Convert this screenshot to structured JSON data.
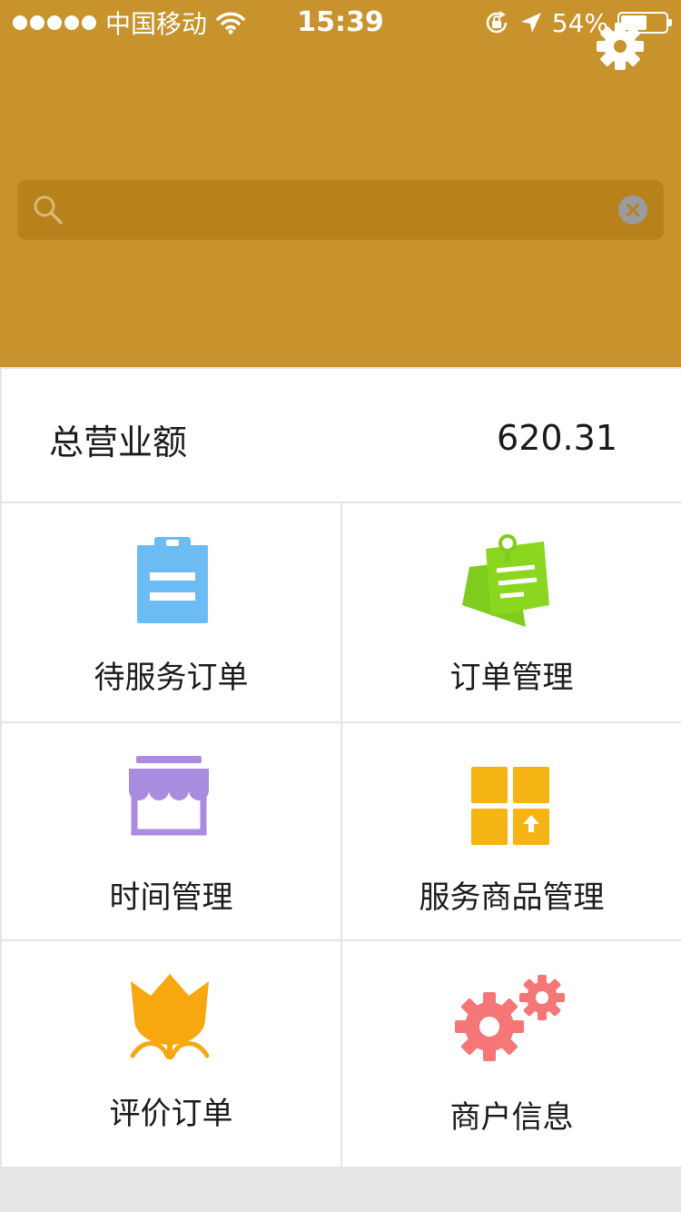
{
  "status_bar": {
    "carrier": "中国移动",
    "time": "15:39",
    "battery": "54%"
  },
  "search": {
    "placeholder": "",
    "value": ""
  },
  "summary": {
    "revenue_label": "总营业额",
    "revenue_value": "620.31"
  },
  "menu": [
    {
      "label": "待服务订单",
      "icon": "clipboard-icon",
      "color": "#6cbcf3"
    },
    {
      "label": "订单管理",
      "icon": "sticky-note-icon",
      "color": "#7fcc1f"
    },
    {
      "label": "时间管理",
      "icon": "shop-awning-icon",
      "color": "#a98be0"
    },
    {
      "label": "服务商品管理",
      "icon": "package-grid-icon",
      "color": "#f6b314"
    },
    {
      "label": "评价订单",
      "icon": "tulip-icon",
      "color": "#f7a80f"
    },
    {
      "label": "商户信息",
      "icon": "gears-icon",
      "color": "#f57676"
    }
  ],
  "colors": {
    "header": "#c8922c",
    "search_bg": "#b7811c"
  }
}
